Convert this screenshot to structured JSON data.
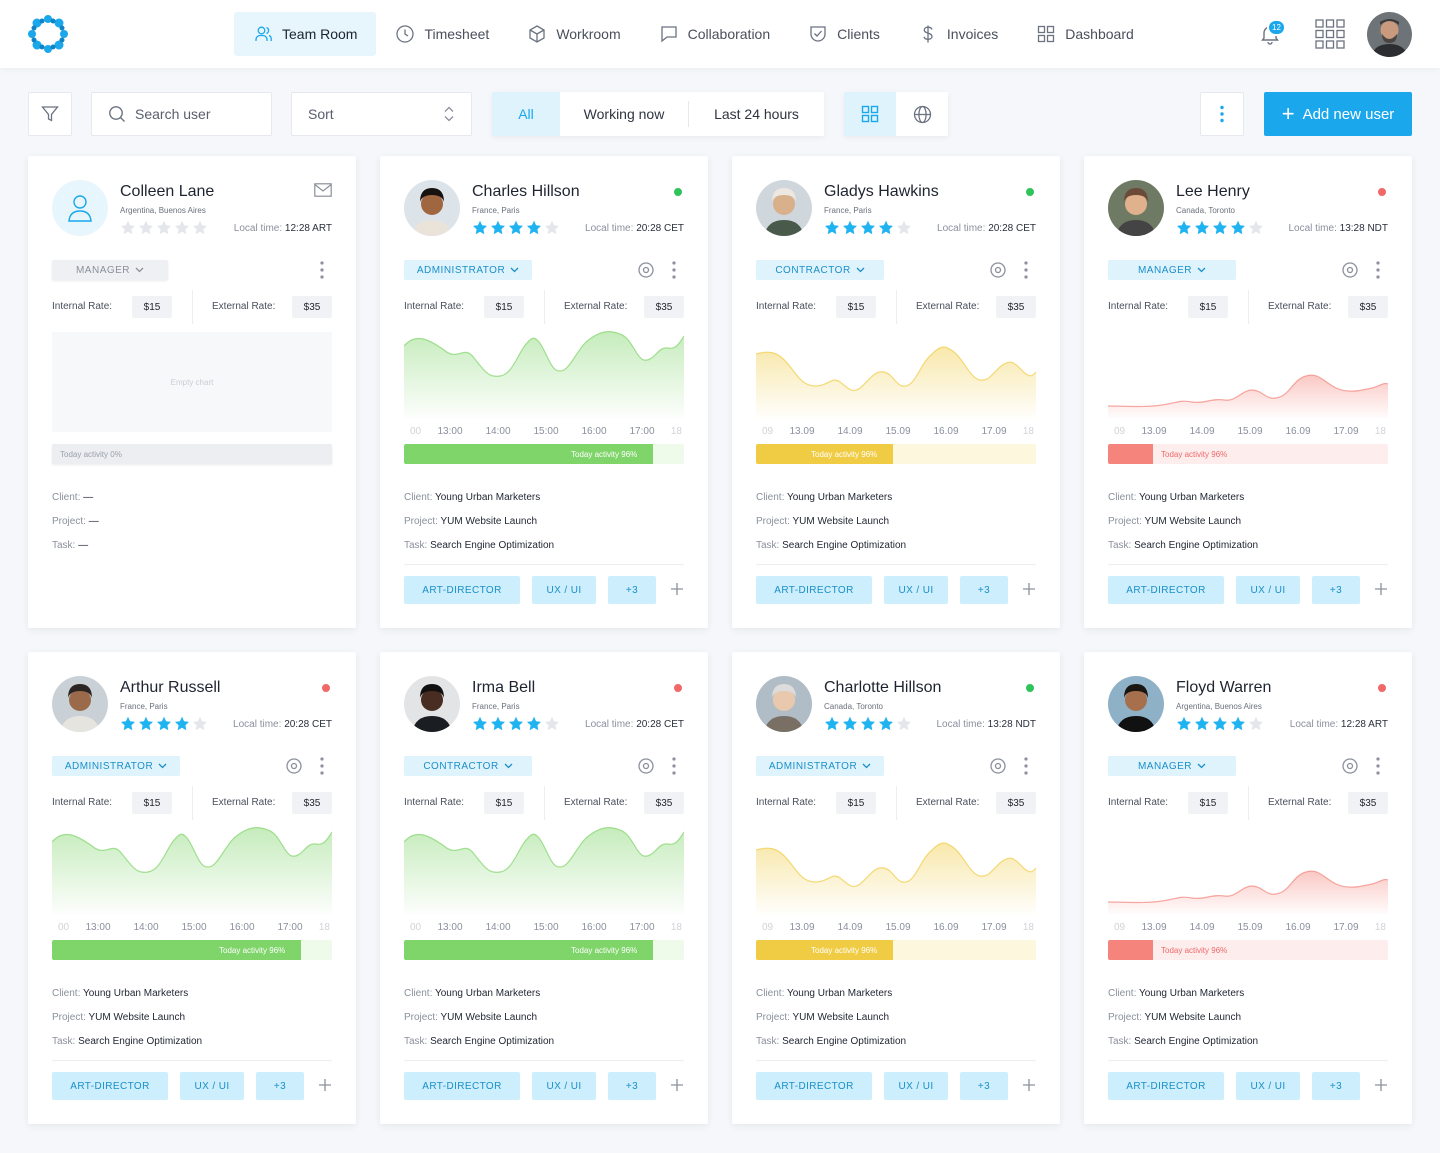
{
  "nav": {
    "items": [
      {
        "label": "Team Room",
        "icon": "users-icon",
        "active": true
      },
      {
        "label": "Timesheet",
        "icon": "clock-icon",
        "active": false
      },
      {
        "label": "Workroom",
        "icon": "cube-icon",
        "active": false
      },
      {
        "label": "Collaboration",
        "icon": "chat-icon",
        "active": false
      },
      {
        "label": "Clients",
        "icon": "shield-check-icon",
        "active": false
      },
      {
        "label": "Invoices",
        "icon": "dollar-icon",
        "active": false
      },
      {
        "label": "Dashboard",
        "icon": "grid-icon",
        "active": false
      }
    ],
    "notifications": "12"
  },
  "toolbar": {
    "search_placeholder": "Search user",
    "sort_label": "Sort",
    "filters": [
      "All",
      "Working now",
      "Last 24 hours"
    ],
    "active_filter": 0,
    "add_label": "Add new user"
  },
  "colors": {
    "accent": "#1aa7ec",
    "online": "#2fc45a",
    "offline": "#f06868",
    "green": "#7fd46a",
    "yellow": "#f0cc45",
    "red": "#f4847c"
  },
  "cards": [
    {
      "name": "Colleen Lane",
      "location": "Argentina, Buenos Aires",
      "rating": 0,
      "local_label": "Local time:",
      "local_time": "12:28 ART",
      "status": "none",
      "role": "MANAGER",
      "internal_label": "Internal Rate:",
      "internal_rate": "$15",
      "external_label": "External Rate:",
      "external_rate": "$35",
      "chart": "empty",
      "empty_chart_label": "Empty chart",
      "activity_text": "Today activity 0%",
      "activity": 0,
      "client_label": "Client:",
      "client": "—",
      "project_label": "Project:",
      "project": "—",
      "task_label": "Task:",
      "task": "—",
      "tags": []
    },
    {
      "name": "Charles Hillson",
      "location": "France, Paris",
      "rating": 4,
      "local_label": "Local time:",
      "local_time": "20:28 CET",
      "status": "online",
      "role": "ADMINISTRATOR",
      "internal_label": "Internal Rate:",
      "internal_rate": "$15",
      "external_label": "External Rate:",
      "external_rate": "$35",
      "chart": "green",
      "ticks": [
        "00",
        "13:00",
        "14:00",
        "15:00",
        "16:00",
        "17:00",
        "18"
      ],
      "activity_text": "Today activity 96%",
      "activity": 0.89,
      "client_label": "Client:",
      "client": "Young Urban Marketers",
      "project_label": "Project:",
      "project": "YUM Website Launch",
      "task_label": "Task:",
      "task": "Search Engine Optimization",
      "tags": [
        "ART-DIRECTOR",
        "UX / UI",
        "+3"
      ]
    },
    {
      "name": "Gladys Hawkins",
      "location": "France, Paris",
      "rating": 4,
      "local_label": "Local time:",
      "local_time": "20:28 CET",
      "status": "online",
      "role": "CONTRACTOR",
      "internal_label": "Internal Rate:",
      "internal_rate": "$15",
      "external_label": "External Rate:",
      "external_rate": "$35",
      "chart": "yellow",
      "ticks": [
        "09",
        "13.09",
        "14.09",
        "15.09",
        "16.09",
        "17.09",
        "18"
      ],
      "activity_text": "Today activity 96%",
      "activity": 0.49,
      "client_label": "Client:",
      "client": "Young Urban Marketers",
      "project_label": "Project:",
      "project": "YUM Website Launch",
      "task_label": "Task:",
      "task": "Search Engine Optimization",
      "tags": [
        "ART-DIRECTOR",
        "UX / UI",
        "+3"
      ]
    },
    {
      "name": "Lee Henry",
      "location": "Canada, Toronto",
      "rating": 4,
      "local_label": "Local time:",
      "local_time": "13:28 NDT",
      "status": "offline",
      "role": "MANAGER",
      "internal_label": "Internal Rate:",
      "internal_rate": "$15",
      "external_label": "External Rate:",
      "external_rate": "$35",
      "chart": "red",
      "ticks": [
        "09",
        "13.09",
        "14.09",
        "15.09",
        "16.09",
        "17.09",
        "18"
      ],
      "activity_text": "Today activity 96%",
      "activity": 0.16,
      "client_label": "Client:",
      "client": "Young Urban Marketers",
      "project_label": "Project:",
      "project": "YUM Website Launch",
      "task_label": "Task:",
      "task": "Search Engine Optimization",
      "tags": [
        "ART-DIRECTOR",
        "UX / UI",
        "+3"
      ]
    },
    {
      "name": "Arthur Russell",
      "location": "France, Paris",
      "rating": 4,
      "local_label": "Local time:",
      "local_time": "20:28 CET",
      "status": "offline",
      "role": "ADMINISTRATOR",
      "internal_label": "Internal Rate:",
      "internal_rate": "$15",
      "external_label": "External Rate:",
      "external_rate": "$35",
      "chart": "green",
      "ticks": [
        "00",
        "13:00",
        "14:00",
        "15:00",
        "16:00",
        "17:00",
        "18"
      ],
      "activity_text": "Today activity 96%",
      "activity": 0.89,
      "client_label": "Client:",
      "client": "Young Urban Marketers",
      "project_label": "Project:",
      "project": "YUM Website Launch",
      "task_label": "Task:",
      "task": "Search Engine Optimization",
      "tags": [
        "ART-DIRECTOR",
        "UX / UI",
        "+3"
      ]
    },
    {
      "name": "Irma Bell",
      "location": "France, Paris",
      "rating": 4,
      "local_label": "Local time:",
      "local_time": "20:28 CET",
      "status": "offline",
      "role": "CONTRACTOR",
      "internal_label": "Internal Rate:",
      "internal_rate": "$15",
      "external_label": "External Rate:",
      "external_rate": "$35",
      "chart": "green",
      "ticks": [
        "00",
        "13:00",
        "14:00",
        "15:00",
        "16:00",
        "17:00",
        "18"
      ],
      "activity_text": "Today activity 96%",
      "activity": 0.89,
      "client_label": "Client:",
      "client": "Young Urban Marketers",
      "project_label": "Project:",
      "project": "YUM Website Launch",
      "task_label": "Task:",
      "task": "Search Engine Optimization",
      "tags": [
        "ART-DIRECTOR",
        "UX / UI",
        "+3"
      ]
    },
    {
      "name": "Charlotte Hillson",
      "location": "Canada, Toronto",
      "rating": 4,
      "local_label": "Local time:",
      "local_time": "13:28 NDT",
      "status": "online",
      "role": "ADMINISTRATOR",
      "internal_label": "Internal Rate:",
      "internal_rate": "$15",
      "external_label": "External Rate:",
      "external_rate": "$35",
      "chart": "yellow",
      "ticks": [
        "09",
        "13.09",
        "14.09",
        "15.09",
        "16.09",
        "17.09",
        "18"
      ],
      "activity_text": "Today activity 96%",
      "activity": 0.49,
      "client_label": "Client:",
      "client": "Young Urban Marketers",
      "project_label": "Project:",
      "project": "YUM Website Launch",
      "task_label": "Task:",
      "task": "Search Engine Optimization",
      "tags": [
        "ART-DIRECTOR",
        "UX / UI",
        "+3"
      ]
    },
    {
      "name": "Floyd Warren",
      "location": "Argentina, Buenos Aires",
      "rating": 4,
      "local_label": "Local time:",
      "local_time": "12:28 ART",
      "status": "offline",
      "role": "MANAGER",
      "internal_label": "Internal Rate:",
      "internal_rate": "$15",
      "external_label": "External Rate:",
      "external_rate": "$35",
      "chart": "red",
      "ticks": [
        "09",
        "13.09",
        "14.09",
        "15.09",
        "16.09",
        "17.09",
        "18"
      ],
      "activity_text": "Today activity 96%",
      "activity": 0.16,
      "client_label": "Client:",
      "client": "Young Urban Marketers",
      "project_label": "Project:",
      "project": "YUM Website Launch",
      "task_label": "Task:",
      "task": "Search Engine Optimization",
      "tags": [
        "ART-DIRECTOR",
        "UX / UI",
        "+3"
      ]
    }
  ]
}
